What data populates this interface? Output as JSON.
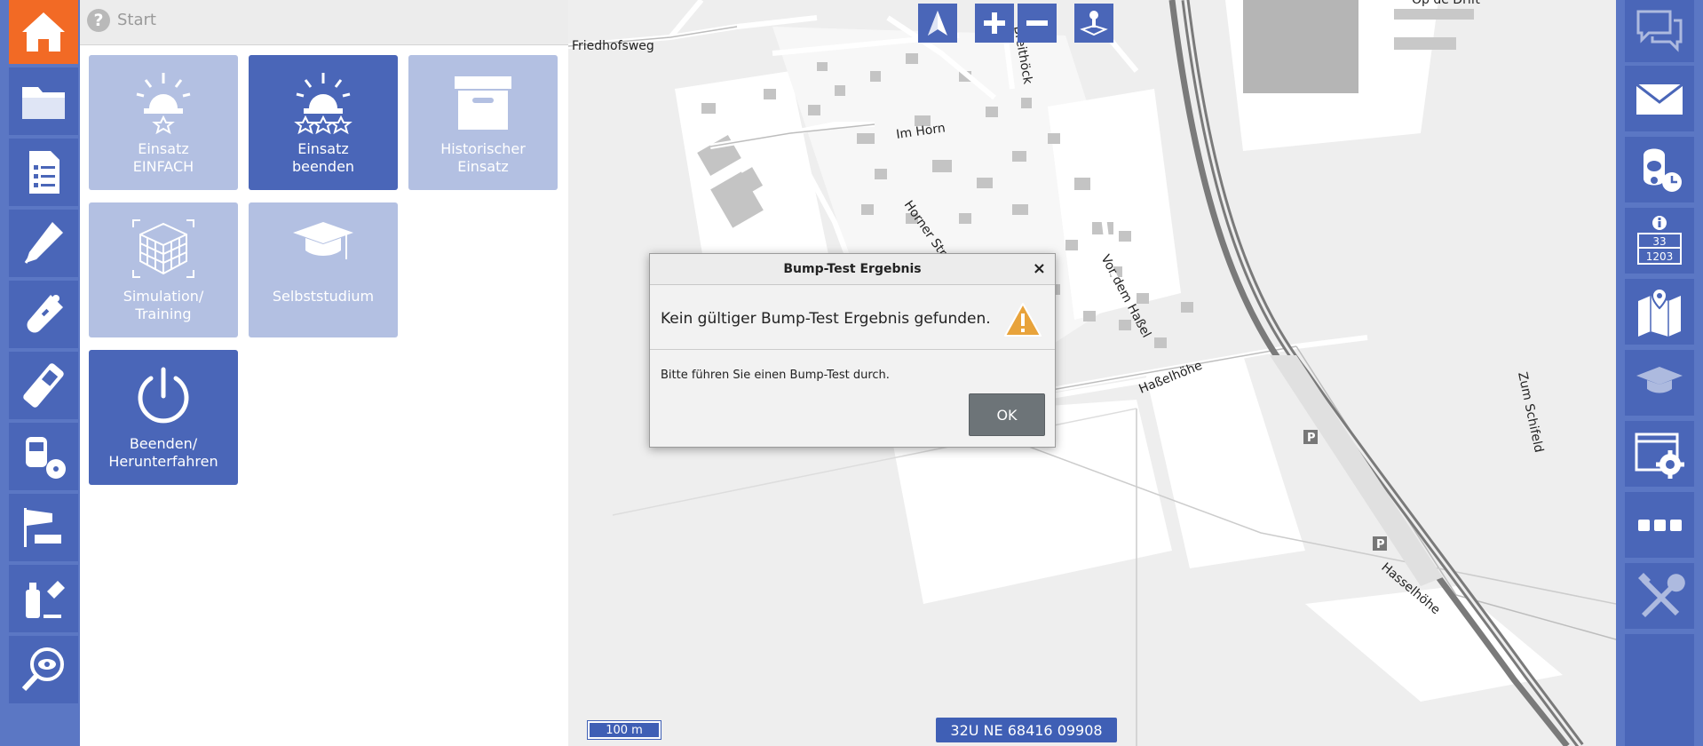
{
  "panel": {
    "title": "Start",
    "tiles": [
      {
        "label": "Einsatz\nEINFACH",
        "icon": "siren-star-icon",
        "state": "inactive"
      },
      {
        "label": "Einsatz\nbeenden",
        "icon": "siren-three-stars-icon",
        "state": "active"
      },
      {
        "label": "Historischer\nEinsatz",
        "icon": "archive-box-icon",
        "state": "inactive"
      },
      {
        "label": "Simulation/\nTraining",
        "icon": "cube-3d-icon",
        "state": "inactive"
      },
      {
        "label": "Selbststudium",
        "icon": "graduation-cap-icon",
        "state": "inactive"
      },
      {
        "label": "Beenden/\nHerunterfahren",
        "icon": "power-icon",
        "state": "active"
      }
    ]
  },
  "left_sidebar": {
    "items": [
      {
        "icon": "home-icon"
      },
      {
        "icon": "folder-icon"
      },
      {
        "icon": "checklist-icon"
      },
      {
        "icon": "probe-pen-icon"
      },
      {
        "icon": "gas-detector-icon"
      },
      {
        "icon": "handheld-device-icon"
      },
      {
        "icon": "radiation-meter-icon"
      },
      {
        "icon": "windsock-icon"
      },
      {
        "icon": "chemical-bottles-icon"
      },
      {
        "icon": "magnifier-eye-icon"
      }
    ]
  },
  "right_sidebar": {
    "items": [
      {
        "icon": "chat-bubbles-icon",
        "enabled": false
      },
      {
        "icon": "envelope-icon",
        "enabled": true
      },
      {
        "icon": "breathing-mask-clock-icon",
        "enabled": true
      },
      {
        "icon": "hazard-info-panel-icon",
        "enabled": true,
        "text_top": "33",
        "text_bottom": "1203"
      },
      {
        "icon": "map-pin-icon",
        "enabled": true
      },
      {
        "icon": "graduation-cap-icon",
        "enabled": false
      },
      {
        "icon": "settings-window-icon",
        "enabled": true
      },
      {
        "icon": "more-dots-icon",
        "enabled": true
      },
      {
        "icon": "tools-icon",
        "enabled": false
      }
    ]
  },
  "map": {
    "street_labels": [
      "Friedhofsweg",
      "Im Horn",
      "Horner Str.",
      "Vor dem Haßel",
      "Haßelhöhe",
      "Hasselhöhe",
      "Zum Schifeld",
      "Op de Drift",
      "Breithöck"
    ],
    "controls": [
      "north-arrow-icon",
      "zoom-in-icon",
      "zoom-out-icon",
      "joystick-icon"
    ],
    "scale_label": "100 m",
    "coordinates": "32U NE 68416 09908",
    "parking_label": "P"
  },
  "dialog": {
    "title": "Bump-Test Ergebnis",
    "close_label": "×",
    "message": "Kein gültiger Bump-Test Ergebnis gefunden.",
    "instruction": "Bitte führen Sie einen Bump-Test durch.",
    "ok_label": "OK"
  },
  "colors": {
    "sidebar_bg": "#5b77c4",
    "button_blue": "#4a66b8",
    "home_orange": "#f26a25",
    "tile_inactive": "#b3c0e2",
    "warning_orange": "#e8a33b"
  }
}
